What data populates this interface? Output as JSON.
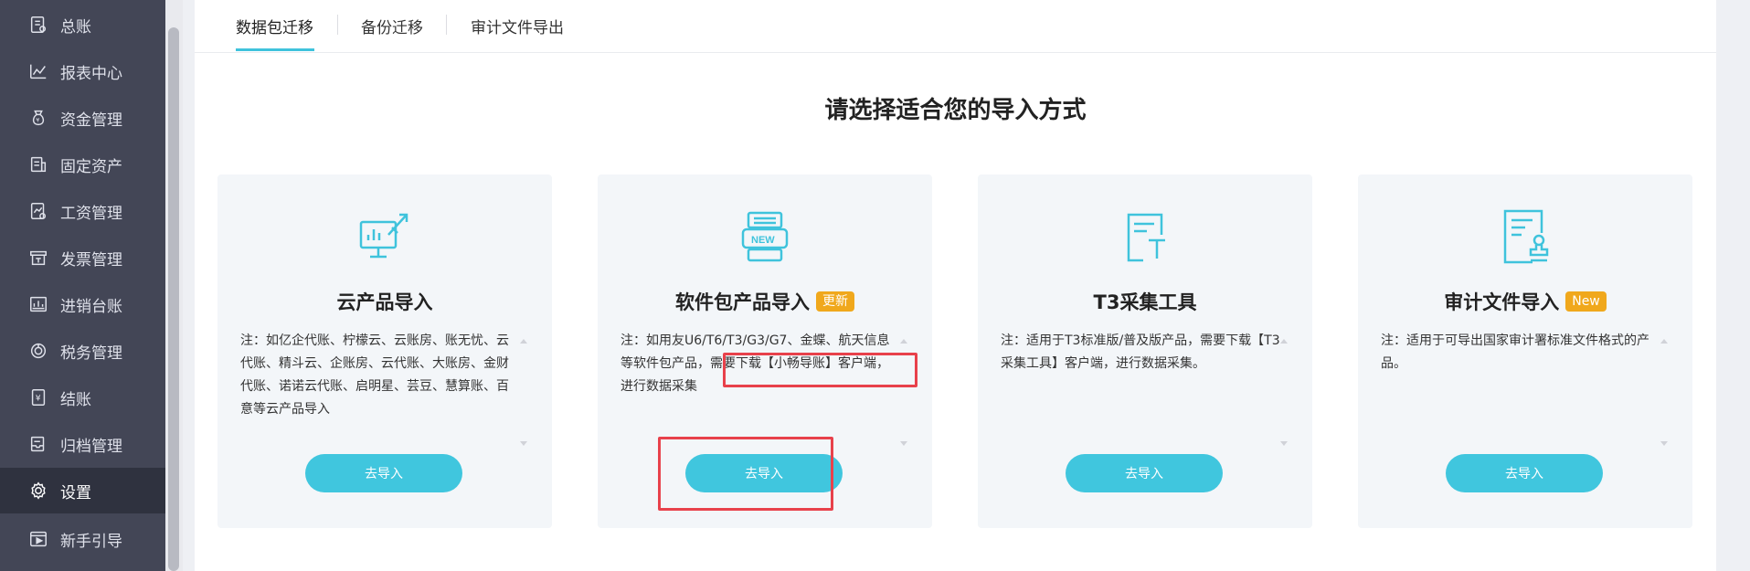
{
  "sidebar": {
    "items": [
      {
        "label": "总账",
        "icon": "ledger-icon"
      },
      {
        "label": "报表中心",
        "icon": "chart-icon"
      },
      {
        "label": "资金管理",
        "icon": "money-bag-icon"
      },
      {
        "label": "固定资产",
        "icon": "asset-icon"
      },
      {
        "label": "工资管理",
        "icon": "salary-icon"
      },
      {
        "label": "发票管理",
        "icon": "invoice-icon"
      },
      {
        "label": "进销台账",
        "icon": "inventory-icon"
      },
      {
        "label": "税务管理",
        "icon": "tax-icon"
      },
      {
        "label": "结账",
        "icon": "checkout-icon"
      },
      {
        "label": "归档管理",
        "icon": "archive-icon"
      },
      {
        "label": "设置",
        "icon": "gear-icon",
        "active": true
      },
      {
        "label": "新手引导",
        "icon": "guide-icon"
      }
    ]
  },
  "tabs": [
    {
      "label": "数据包迁移",
      "active": true
    },
    {
      "label": "备份迁移"
    },
    {
      "label": "审计文件导出"
    }
  ],
  "page_title": "请选择适合您的导入方式",
  "cards": [
    {
      "icon": "cloud-screen-rocket-icon",
      "title": "云产品导入",
      "badge": "",
      "desc": "注：如亿企代账、柠檬云、云账房、账无忧、云代账、精斗云、企账房、云代账、大账房、金财代账、诺诺云代账、启明星、芸豆、慧算账、百意等云产品导入",
      "button": "去导入"
    },
    {
      "icon": "new-package-icon",
      "title": "软件包产品导入",
      "badge": "更新",
      "desc": "注：如用友U6/T6/T3/G3/G7、金蝶、航天信息等软件包产品，需要下载【小畅导账】客户端，进行数据采集",
      "button": "去导入"
    },
    {
      "icon": "t3-tool-icon",
      "title": "T3采集工具",
      "badge": "",
      "desc": "注：适用于T3标准版/普及版产品，需要下载【T3采集工具】客户端，进行数据采集。",
      "button": "去导入"
    },
    {
      "icon": "audit-file-stamp-icon",
      "title": "审计文件导入",
      "badge": "New",
      "desc": "注：适用于可导出国家审计署标准文件格式的产品。",
      "button": "去导入"
    }
  ],
  "colors": {
    "accent": "#40c6de",
    "badge": "#f0a81c",
    "highlight": "#e8414b",
    "sidebar_bg": "#434656"
  }
}
